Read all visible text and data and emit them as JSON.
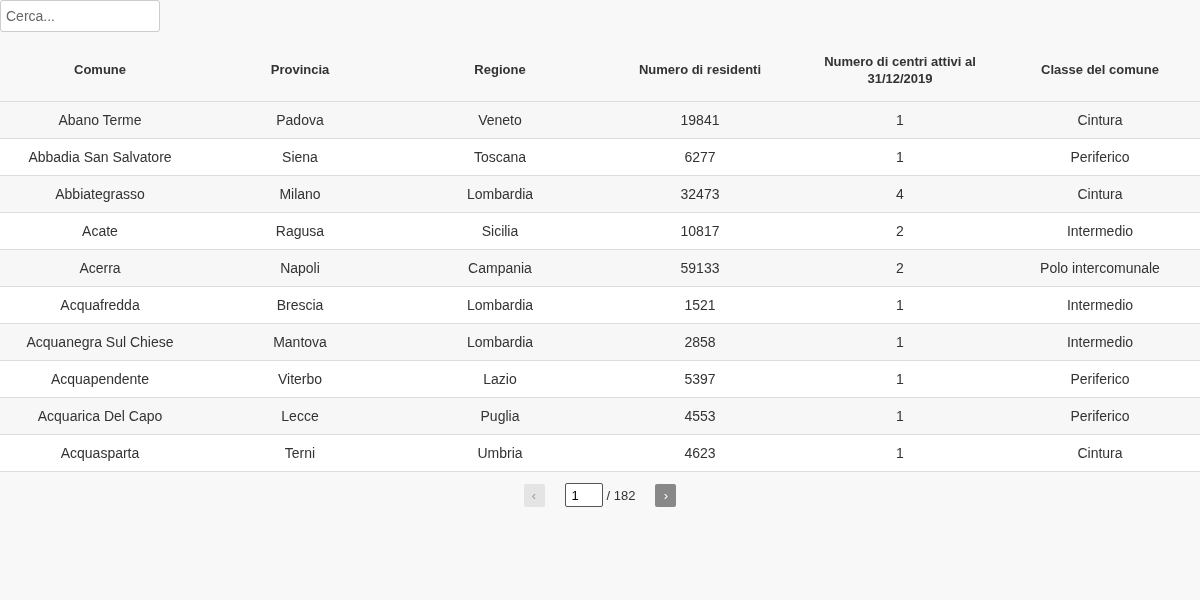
{
  "search": {
    "placeholder": "Cerca..."
  },
  "table": {
    "columns": [
      "Comune",
      "Provincia",
      "Regione",
      "Numero di residenti",
      "Numero di centri attivi al 31/12/2019",
      "Classe del comune"
    ],
    "rows": [
      [
        "Abano Terme",
        "Padova",
        "Veneto",
        "19841",
        "1",
        "Cintura"
      ],
      [
        "Abbadia San Salvatore",
        "Siena",
        "Toscana",
        "6277",
        "1",
        "Periferico"
      ],
      [
        "Abbiategrasso",
        "Milano",
        "Lombardia",
        "32473",
        "4",
        "Cintura"
      ],
      [
        "Acate",
        "Ragusa",
        "Sicilia",
        "10817",
        "2",
        "Intermedio"
      ],
      [
        "Acerra",
        "Napoli",
        "Campania",
        "59133",
        "2",
        "Polo intercomunale"
      ],
      [
        "Acquafredda",
        "Brescia",
        "Lombardia",
        "1521",
        "1",
        "Intermedio"
      ],
      [
        "Acquanegra Sul Chiese",
        "Mantova",
        "Lombardia",
        "2858",
        "1",
        "Intermedio"
      ],
      [
        "Acquapendente",
        "Viterbo",
        "Lazio",
        "5397",
        "1",
        "Periferico"
      ],
      [
        "Acquarica Del Capo",
        "Lecce",
        "Puglia",
        "4553",
        "1",
        "Periferico"
      ],
      [
        "Acquasparta",
        "Terni",
        "Umbria",
        "4623",
        "1",
        "Cintura"
      ]
    ]
  },
  "pagination": {
    "prev": {
      "label": "‹",
      "disabled": true
    },
    "page": "1",
    "total": "/ 182",
    "next": {
      "label": "›",
      "disabled": false
    }
  }
}
